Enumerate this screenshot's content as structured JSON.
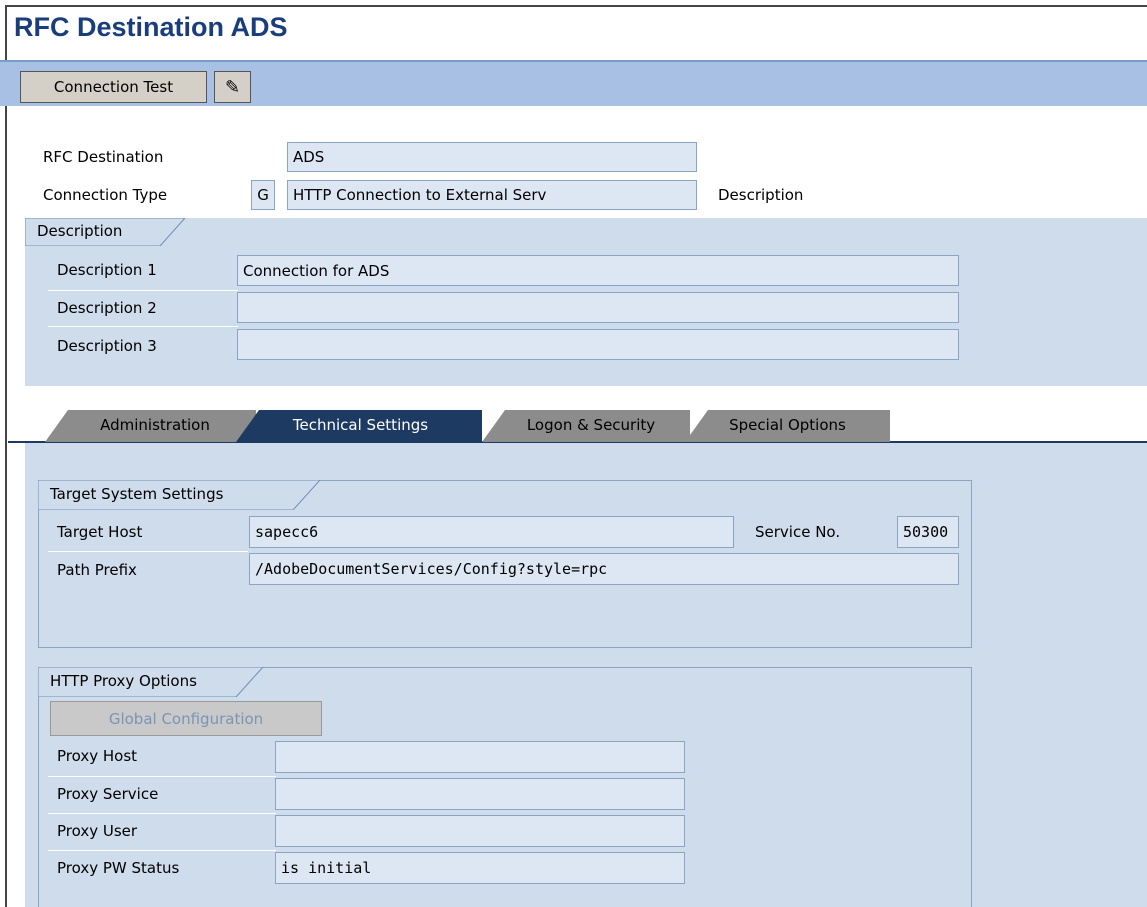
{
  "window": {
    "title": "RFC Destination ADS"
  },
  "toolbar": {
    "connection_test_label": "Connection Test",
    "edit_icon": "edit-pencil-icon"
  },
  "header": {
    "rfc_destination_label": "RFC Destination",
    "rfc_destination_value": "ADS",
    "connection_type_label": "Connection Type",
    "connection_type_code": "G",
    "connection_type_value": "HTTP Connection to External Serv",
    "description_label": "Description"
  },
  "description": {
    "group_title": "Description",
    "rows": [
      {
        "label": "Description 1",
        "value": "Connection for ADS"
      },
      {
        "label": "Description 2",
        "value": ""
      },
      {
        "label": "Description 3",
        "value": ""
      }
    ]
  },
  "tabs": [
    {
      "label": "Administration",
      "active": false
    },
    {
      "label": "Technical Settings",
      "active": true
    },
    {
      "label": "Logon & Security",
      "active": false
    },
    {
      "label": "Special Options",
      "active": false
    }
  ],
  "target": {
    "group_title": "Target System Settings",
    "target_host_label": "Target Host",
    "target_host_value": "sapecc6",
    "service_no_label": "Service No.",
    "service_no_value": "50300",
    "path_prefix_label": "Path Prefix",
    "path_prefix_value": "/AdobeDocumentServices/Config?style=rpc"
  },
  "proxy": {
    "group_title": "HTTP Proxy Options",
    "global_config_label": "Global Configuration",
    "rows": [
      {
        "label": "Proxy Host",
        "value": ""
      },
      {
        "label": "Proxy Service",
        "value": ""
      },
      {
        "label": "Proxy User",
        "value": ""
      },
      {
        "label": "Proxy PW Status",
        "value": "is initial"
      }
    ]
  },
  "colors": {
    "title": "#1a3d7c",
    "toolbar": "#a7c0e3",
    "panel": "#cfdcec",
    "field": "#dde7f3",
    "tab_inactive": "#8c8c8c",
    "tab_active": "#1c3a62"
  }
}
